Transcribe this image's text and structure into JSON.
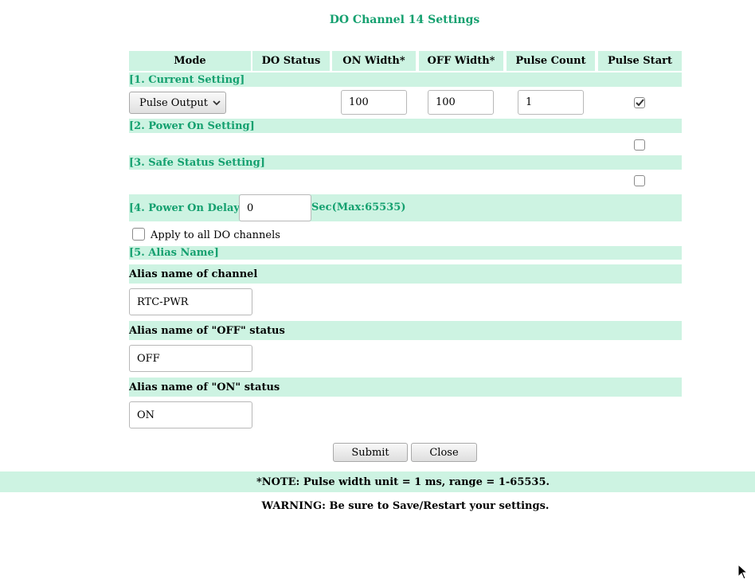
{
  "page": {
    "title": "DO Channel 14  Settings"
  },
  "table_header": {
    "mode": "Mode",
    "do_status": "DO Status",
    "on_width": "ON Width*",
    "off_width": "OFF Width*",
    "pulse_count": "Pulse Count",
    "pulse_start": "Pulse Start"
  },
  "current_setting": {
    "label": "[1. Current Setting]",
    "mode_value": "Pulse Output",
    "on_width": "100",
    "off_width": "100",
    "pulse_count": "1",
    "pulse_start_checked": true
  },
  "power_on_setting": {
    "label": "[2. Power On Setting]",
    "pulse_start_checked": false
  },
  "safe_status_setting": {
    "label": "[3. Safe Status Setting]",
    "pulse_start_checked": false
  },
  "power_on_delay": {
    "label": "[4. Power On Delay]",
    "value": "0",
    "unit_label": "Sec(Max:65535)"
  },
  "apply_all": {
    "label": "Apply to all DO channels",
    "checked": false
  },
  "alias": {
    "section_label": "[5. Alias Name]",
    "channel_label": "Alias name of channel",
    "channel_value": "RTC-PWR",
    "off_label": "Alias name of \"OFF\" status",
    "off_value": "OFF",
    "on_label": "Alias name of \"ON\" status",
    "on_value": "ON"
  },
  "buttons": {
    "submit": "Submit",
    "close": "Close"
  },
  "footer": {
    "note": "*NOTE: Pulse width unit = 1 ms, range = 1-65535.",
    "warning": "WARNING: Be sure to Save/Restart your settings."
  },
  "colors": {
    "accent_green": "#14a06f",
    "band_background": "#cdf3e2"
  },
  "icons": {
    "select_arrow": "chevron-down-icon",
    "checkmark": "check-icon",
    "cursor": "mouse-pointer-icon"
  }
}
